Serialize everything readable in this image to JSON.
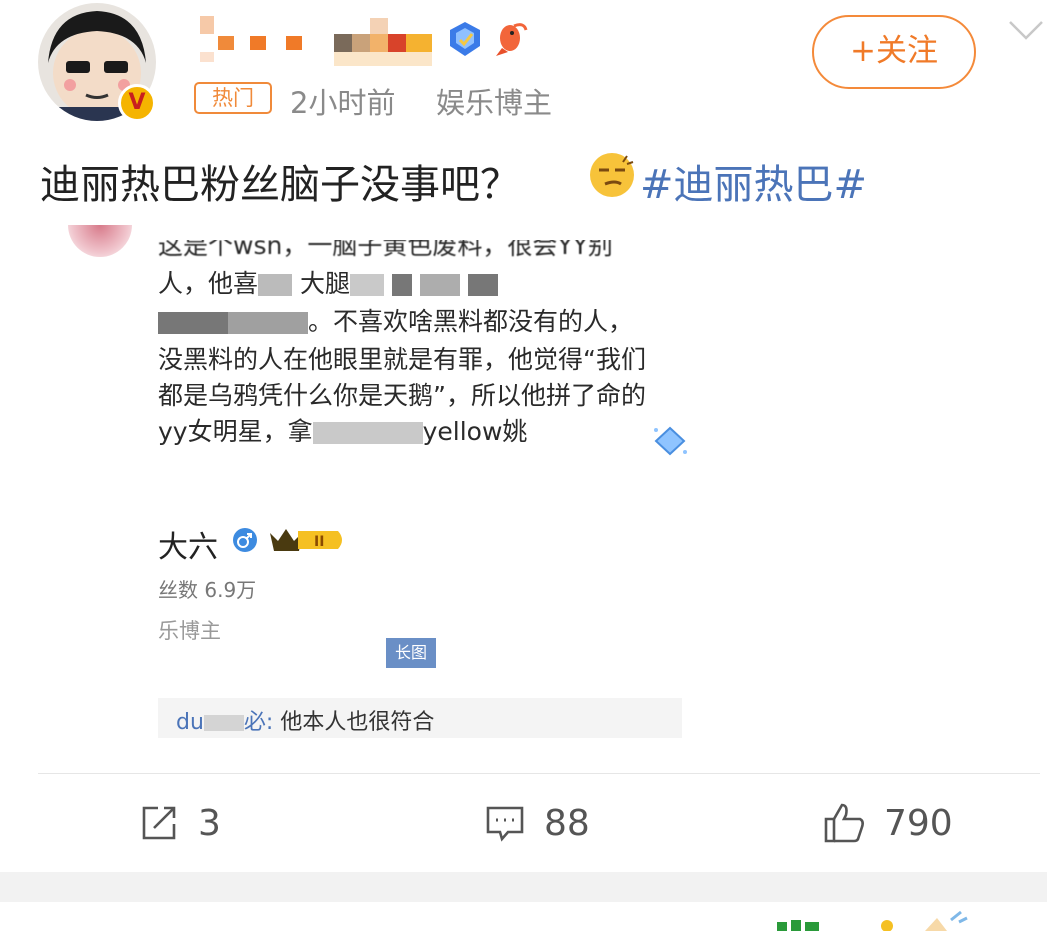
{
  "header": {
    "hot_tag": "热门",
    "time": "2小时前",
    "category": "娱乐博主",
    "follow_label": "+关注"
  },
  "post": {
    "text": "迪丽热巴粉丝脑子没事吧？",
    "hashtag": "#迪丽热巴#"
  },
  "embedded_screenshot": {
    "line1": "这是个wsn，一脑子黄色废料，很会YY别",
    "line2_start": "人，他喜",
    "line2_mid": "大腿",
    "line3_end": "。不喜欢啥黑料都没有的人，",
    "line4": "没黑料的人在他眼里就是有罪，他觉得“我们",
    "line5": "都是乌鸦凭什么你是天鹅”，所以他拼了命的",
    "line6_start": "yy女明星，拿",
    "line6_end": "yellow姚",
    "user_name": "大六",
    "fans": "丝数 6.9万",
    "blogger": "乐博主",
    "long_tag": "长图",
    "reply_nick": "du",
    "reply_nick_end": "必:",
    "reply_text": " 他本人也很符合"
  },
  "actions": {
    "share_count": "3",
    "comment_count": "88",
    "like_count": "790"
  },
  "colors": {
    "accent_orange": "#f07a28",
    "link_blue": "#4b74b8"
  }
}
